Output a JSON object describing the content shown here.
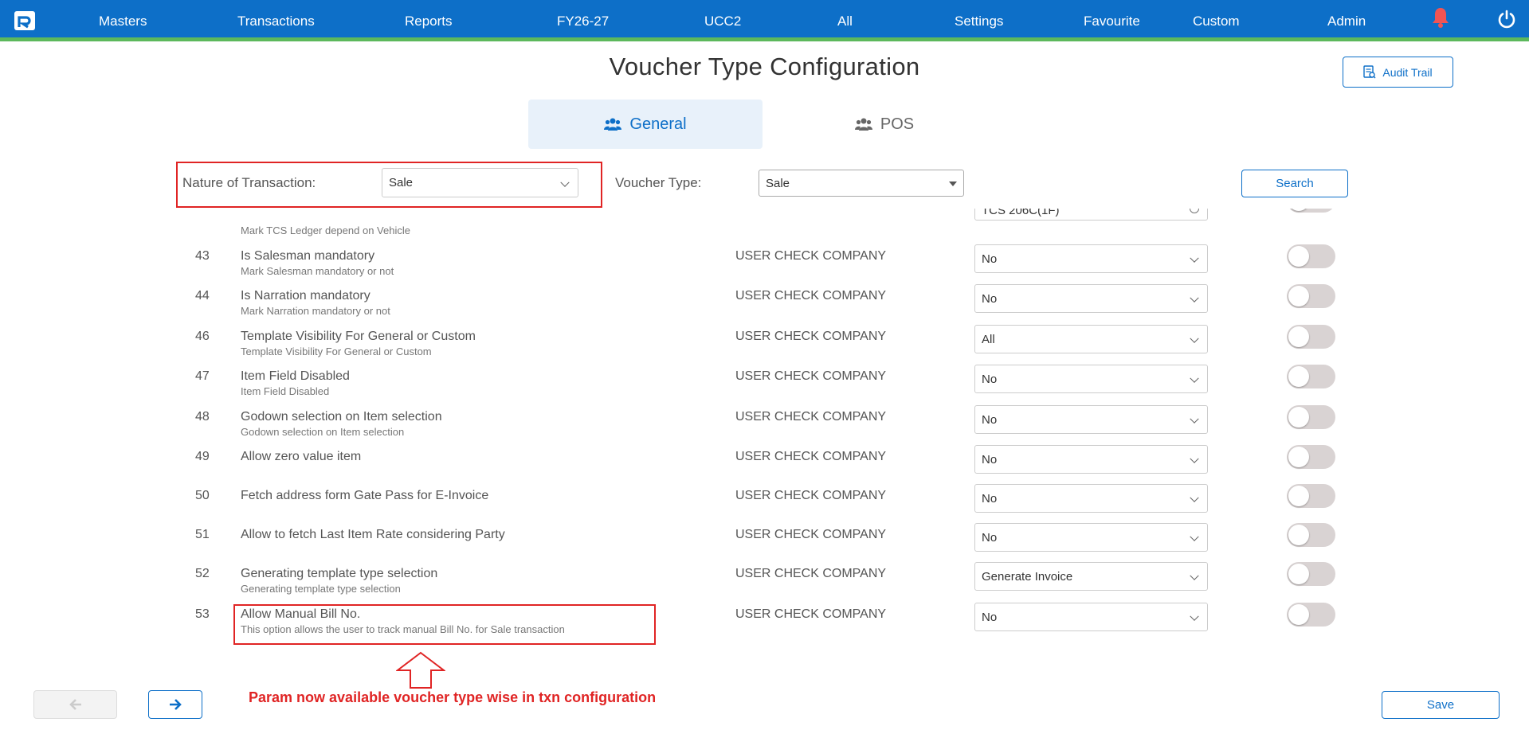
{
  "nav": {
    "items": [
      "Masters",
      "Transactions",
      "Reports",
      "FY26-27",
      "UCC2",
      "All",
      "Settings",
      "Favourite",
      "Custom",
      "Admin"
    ],
    "colors": {
      "bar": "#0d6fc8",
      "accent_stripe": "#5cb85c",
      "bell": "#f05454"
    }
  },
  "header": {
    "title": "Voucher Type Configuration",
    "audit_trail_label": "Audit Trail"
  },
  "tabs": [
    {
      "label": "General",
      "active": true,
      "icon": "users-icon"
    },
    {
      "label": "POS",
      "active": false,
      "icon": "users-icon"
    }
  ],
  "filters": {
    "nature_label": "Nature of Transaction:",
    "nature_value": "Sale",
    "voucher_type_label": "Voucher Type:",
    "voucher_type_value": "Sale",
    "search_label": "Search"
  },
  "partial_row": {
    "desc": "Mark TCS Ledger depend on Vehicle",
    "value": "TCS 206C(1F)"
  },
  "rows": [
    {
      "num": "43",
      "name": "Is Salesman mandatory",
      "desc": "Mark Salesman mandatory or not",
      "company": "USER CHECK COMPANY",
      "value": "No"
    },
    {
      "num": "44",
      "name": "Is Narration mandatory",
      "desc": "Mark Narration mandatory or not",
      "company": "USER CHECK COMPANY",
      "value": "No"
    },
    {
      "num": "46",
      "name": "Template Visibility For General or Custom",
      "desc": "Template Visibility For General or Custom",
      "company": "USER CHECK COMPANY",
      "value": "All"
    },
    {
      "num": "47",
      "name": "Item Field Disabled",
      "desc": "Item Field Disabled",
      "company": "USER CHECK COMPANY",
      "value": "No"
    },
    {
      "num": "48",
      "name": "Godown selection on Item selection",
      "desc": "Godown selection on Item selection",
      "company": "USER CHECK COMPANY",
      "value": "No"
    },
    {
      "num": "49",
      "name": "Allow zero value item",
      "desc": "",
      "company": "USER CHECK COMPANY",
      "value": "No"
    },
    {
      "num": "50",
      "name": "Fetch address form Gate Pass for E-Invoice",
      "desc": "",
      "company": "USER CHECK COMPANY",
      "value": "No"
    },
    {
      "num": "51",
      "name": "Allow to fetch Last Item Rate considering Party",
      "desc": "",
      "company": "USER CHECK COMPANY",
      "value": "No"
    },
    {
      "num": "52",
      "name": "Generating template type selection",
      "desc": "Generating template type selection",
      "company": "USER CHECK COMPANY",
      "value": "Generate Invoice"
    },
    {
      "num": "53",
      "name": "Allow Manual Bill No.",
      "desc": "This option allows the user to track manual Bill No. for Sale transaction",
      "company": "USER CHECK COMPANY",
      "value": "No"
    }
  ],
  "footer": {
    "save_label": "Save",
    "annotation": "Param now available voucher type wise in txn configuration"
  }
}
